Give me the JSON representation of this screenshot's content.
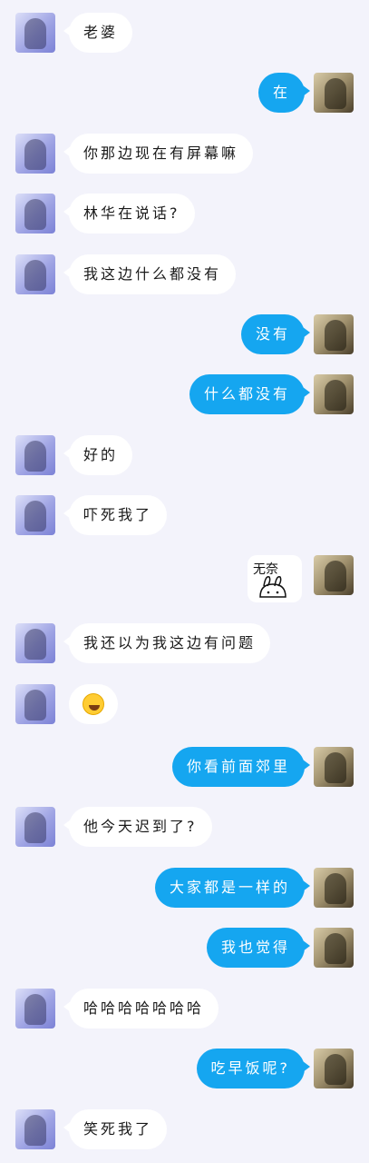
{
  "messages": [
    {
      "side": "left",
      "text": "老婆"
    },
    {
      "side": "right",
      "text": "在"
    },
    {
      "side": "left",
      "text": "你那边现在有屏幕嘛"
    },
    {
      "side": "left",
      "text": "林华在说话?"
    },
    {
      "side": "left",
      "text": "我这边什么都没有"
    },
    {
      "side": "right",
      "text": "没有"
    },
    {
      "side": "right",
      "text": "什么都没有"
    },
    {
      "side": "left",
      "text": "好的"
    },
    {
      "side": "left",
      "text": "吓死我了"
    },
    {
      "side": "right",
      "type": "sticker",
      "sticker_text": "无奈"
    },
    {
      "side": "left",
      "text": "我还以为我这边有问题"
    },
    {
      "side": "left",
      "type": "emoji",
      "emoji": "joy-emoji"
    },
    {
      "side": "right",
      "text": "你看前面郊里"
    },
    {
      "side": "left",
      "text": "他今天迟到了?"
    },
    {
      "side": "right",
      "text": "大家都是一样的"
    },
    {
      "side": "right",
      "text": "我也觉得"
    },
    {
      "side": "left",
      "text": "哈哈哈哈哈哈哈"
    },
    {
      "side": "right",
      "text": "吃早饭呢?"
    },
    {
      "side": "left",
      "text": "笑死我了"
    }
  ],
  "colors": {
    "background": "#f3f3fb",
    "bubble_right": "#15a6f0",
    "bubble_left": "#ffffff"
  }
}
